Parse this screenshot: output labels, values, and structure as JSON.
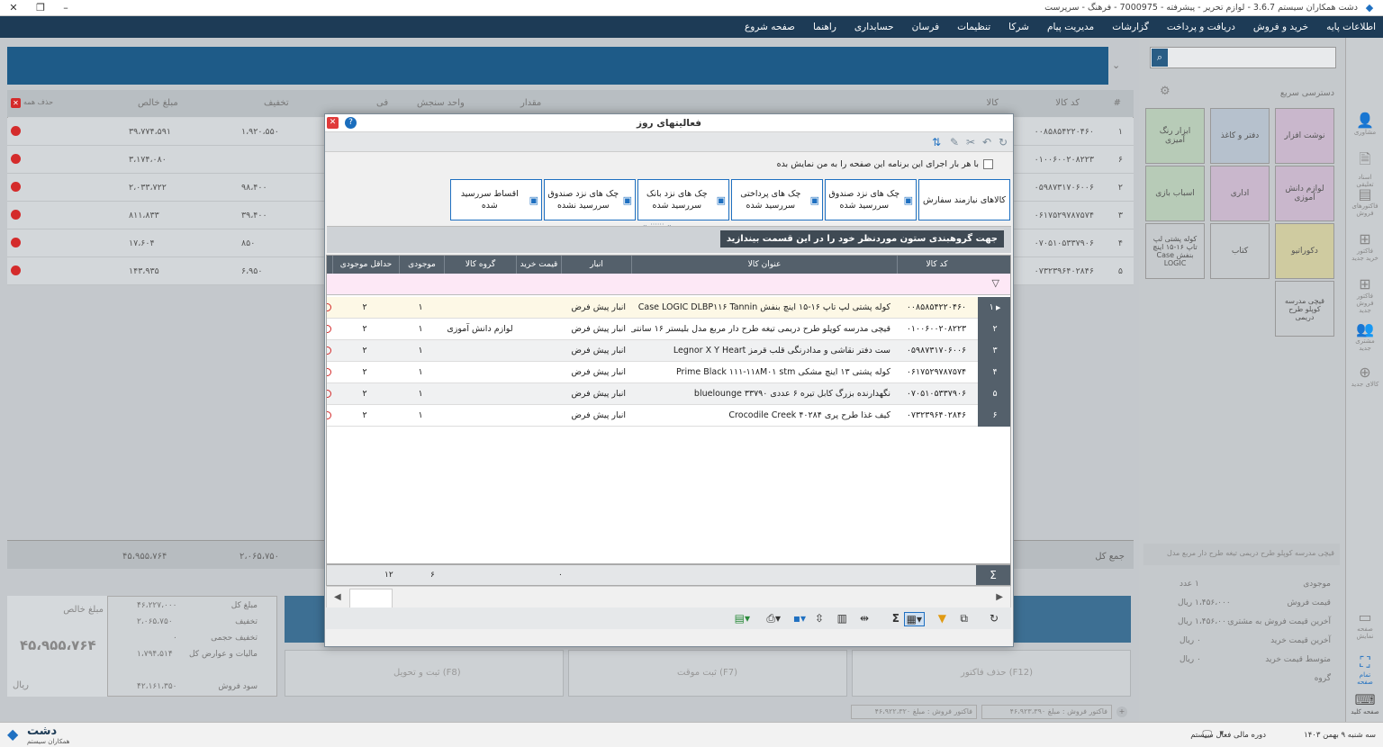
{
  "window": {
    "title": "دشت همکاران سیستم 3.6.7 - لوازم تحریر - پیشرفته - 7000975 - فرهنگ - سرپرست"
  },
  "menu": [
    "اطلاعات پایه",
    "خرید و فروش",
    "دریافت و پرداخت",
    "گزارشات",
    "مدیریت پیام",
    "شرکا",
    "تنظیمات",
    "فرسان",
    "حسابداری",
    "راهنما",
    "صفحه شروع"
  ],
  "background": {
    "grid_headers": [
      "#",
      "کد کالا",
      "کالا",
      "مقدار",
      "واحد سنجش",
      "فی",
      "تخفیف",
      "مبلغ خالص",
      "حذف همه"
    ],
    "rows": [
      {
        "n": "۱",
        "code": "۰۰۸۵۸۵۴۲۲۰۴۶۰",
        "amount": "۳۹،۷۷۴،۵۹۱",
        "discount": "۱،۹۲۰،۵۵۰"
      },
      {
        "n": "۶",
        "code": "۰۱۰۰۶۰۰۲۰۸۲۲۳",
        "amount": "۳،۱۷۴،۰۸۰",
        "discount": ""
      },
      {
        "n": "۲",
        "code": "۰۵۹۸۷۳۱۷۰۶۰۰۶",
        "amount": "۲،۰۳۳،۷۲۲",
        "discount": "۹۸،۴۰۰"
      },
      {
        "n": "۳",
        "code": "۰۶۱۷۵۲۹۷۸۷۵۷۴",
        "amount": "۸۱۱،۸۳۳",
        "discount": "۳۹،۴۰۰"
      },
      {
        "n": "۴",
        "code": "۰۷۰۵۱۰۵۳۳۷۹۰۶",
        "amount": "۱۷،۶۰۴",
        "discount": "۸۵۰"
      },
      {
        "n": "۵",
        "code": "۰۷۳۲۳۹۶۴۰۲۸۴۶",
        "amount": "۱۴۳،۹۳۵",
        "discount": "۶،۹۵۰"
      }
    ],
    "sum_label": "جمع کل",
    "sum_amount": "۴۵،۹۵۵،۷۶۴",
    "sum_discount": "۲،۰۶۵،۷۵۰",
    "net_label": "مبلغ خالص",
    "net_value": "۴۵،۹۵۵،۷۶۴",
    "currency": "ریال",
    "totals": [
      {
        "label": "مبلغ کل",
        "value": "۴۶،۲۲۷،۰۰۰"
      },
      {
        "label": "تخفیف",
        "value": "۲،۰۶۵،۷۵۰"
      },
      {
        "label": "تخفیف حجمی",
        "value": "۰"
      },
      {
        "label": "مالیات و عوارض کل",
        "value": "۱،۷۹۴،۵۱۴"
      },
      {
        "label": "سود فروش",
        "value": "۴۲،۱۶۱،۳۵۰"
      }
    ],
    "action_buttons": [
      "ثبت و تحویل (F8)",
      "ثبت موقت (F7)",
      "حذف فاکتور (F12)"
    ],
    "footer_buttons": [
      "فاکتور فروش : مبلغ ۴۶،۹۲۲،۳۲۰",
      "فاکتور فروش : مبلغ ۴۶،۹۲۳،۳۹۰"
    ]
  },
  "rightpanel": {
    "quick_access": "دسترسی سریع",
    "tiles": [
      "نوشت افزار",
      "دفتر و کاغذ",
      "ابزار رنگ آمیزی",
      "لوازم دانش آموزی",
      "اداری",
      "اسباب بازی",
      "دکوراتیو",
      "کتاب",
      "کوله پشتی لپ تاپ ۱۶-۱۵ اینچ بنفش Case LOGIC",
      "قیچی مدرسه کوپلو طرح دریمی"
    ],
    "product_note": "قیچی مدرسه کوپلو طرح دریمی تیغه طرح دار مربع مدل",
    "info": [
      {
        "label": "موجودی",
        "value": "۱ عدد"
      },
      {
        "label": "قیمت فروش",
        "value": "۱،۴۵۶،۰۰۰ ریال"
      },
      {
        "label": "آخرین قیمت فروش به مشتری",
        "value": "۱،۴۵۶،۰۰۰ ریال"
      },
      {
        "label": "آخرین قیمت خرید",
        "value": "۰ ریال"
      },
      {
        "label": "متوسط قیمت خرید",
        "value": "۰ ریال"
      },
      {
        "label": "گروه",
        "value": ""
      }
    ],
    "icon_labels": [
      "مشاوری",
      "اسناد تعلیقی",
      "فاکتورهای فروش",
      "فاکتور خرید جدید",
      "فاکتور فروش جدید",
      "مشتری جدید",
      "کالای جدید",
      "صفحه نمایش",
      "تمام صفحه",
      "صفحه کلید"
    ]
  },
  "status": {
    "date": "سه شنبه ۹ بهمن ۱۴۰۳",
    "period": "دوره مالی فعال سیستم",
    "logo": "دشت",
    "logo_sub": "همکاران سیستم"
  },
  "dialog": {
    "title": "فعالیتهای روز",
    "show_on_start": "با هر بار اجرای این برنامه این صفحه را به من نمایش بده",
    "buttons": [
      "کالاهای نیازمند سفارش",
      "چک های نزد صندوق سررسید شده",
      "چک های پرداختی سررسید شده",
      "چک های نزد بانک سررسید شده",
      "چک های نزد صندوق سررسید نشده",
      "اقساط سررسید شده"
    ],
    "group_hint": "جهت گروهبندی ستون موردنظر خود را در این قسمت بیندازید",
    "columns": [
      "کد کالا",
      "عنوان کالا",
      "انبار",
      "قیمت خرید",
      "گروه کالا",
      "موجودی",
      "حداقل موجودی"
    ],
    "rows": [
      {
        "n": "۱",
        "code": "۰۰۸۵۸۵۴۲۲۰۴۶۰",
        "name": "کوله پشتی لپ تاپ ۱۶-۱۵ اینچ بنفش Case LOGIC DLBP۱۱۶ Tannin",
        "ware": "انبار پیش فرض",
        "group": "",
        "stock": "۱",
        "min": "۲"
      },
      {
        "n": "۲",
        "code": "۰۱۰۰۶۰۰۲۰۸۲۲۳",
        "name": "قیچی مدرسه کوپلو طرح دریمی تیغه طرح دار مربع مدل بلیستر ۱۶ سانتی",
        "ware": "انبار پیش فرض",
        "group": "لوازم دانش آموزی",
        "stock": "۱",
        "min": "۲"
      },
      {
        "n": "۳",
        "code": "۰۵۹۸۷۳۱۷۰۶۰۰۶",
        "name": "ست دفتر نقاشی و مدادرنگی قلب قرمز Legnor X Y Heart",
        "ware": "انبار پیش فرض",
        "group": "",
        "stock": "۱",
        "min": "۲"
      },
      {
        "n": "۴",
        "code": "۰۶۱۷۵۲۹۷۸۷۵۷۴",
        "name": "کوله پشتی ۱۳ اینچ مشکی Prime Black ۱۱۱-۱۱۸M۰۱ stm",
        "ware": "انبار پیش فرض",
        "group": "",
        "stock": "۱",
        "min": "۲"
      },
      {
        "n": "۵",
        "code": "۰۷۰۵۱۰۵۳۳۷۹۰۶",
        "name": "نگهدارنده بزرگ کابل تیره ۶ عددی ۳۳۷۹۰ bluelounge",
        "ware": "انبار پیش فرض",
        "group": "",
        "stock": "۱",
        "min": "۲"
      },
      {
        "n": "۶",
        "code": "۰۷۳۲۳۹۶۴۰۲۸۴۶",
        "name": "کیف غذا طرح پری ۴۰۲۸۴ Crocodile Creek",
        "ware": "انبار پیش فرض",
        "group": "",
        "stock": "۱",
        "min": "۲"
      }
    ],
    "sum_price": "۰",
    "sum_stock": "۶",
    "sum_min": "۱۲"
  }
}
